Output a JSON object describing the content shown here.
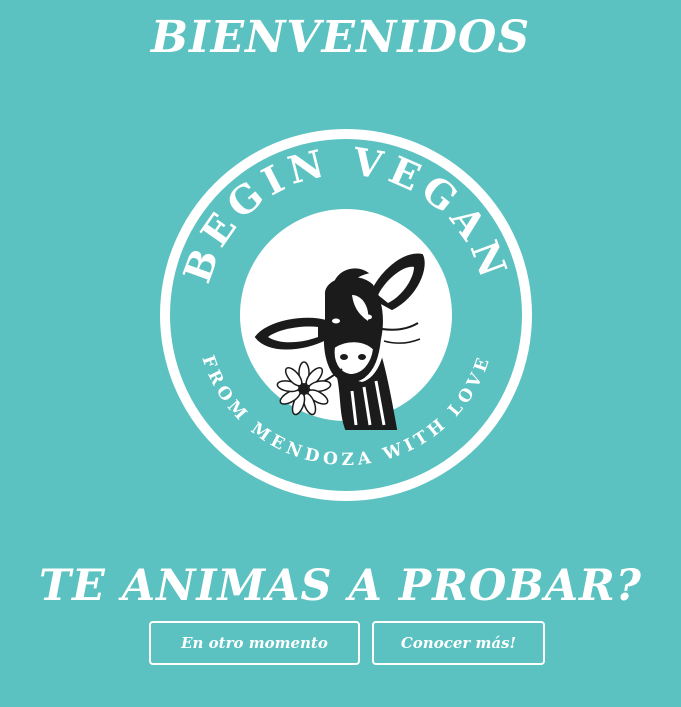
{
  "header": {
    "title": "BIENVENIDOS"
  },
  "logo": {
    "top_text": "BEGIN VEGAN",
    "bottom_text": "FROM MENDOZA WITH LOVE",
    "emblem": "cow-with-flower-icon"
  },
  "prompt": {
    "question": "TE ANIMAS A PROBAR?"
  },
  "buttons": {
    "later_label": "En otro momento",
    "more_label": "Conocer más!"
  },
  "colors": {
    "background": "#5bc2c1",
    "foreground": "#ffffff",
    "ink": "#1b1b1b"
  }
}
